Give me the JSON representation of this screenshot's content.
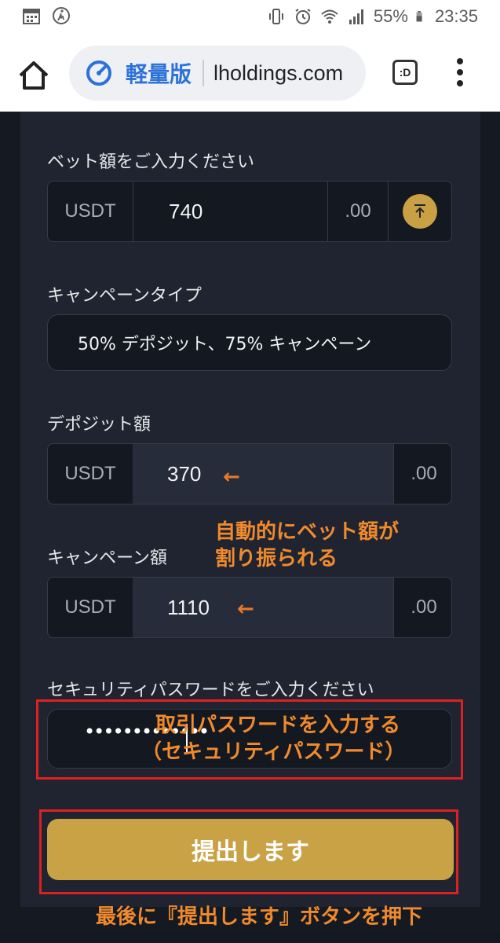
{
  "status_bar": {
    "battery": "55%",
    "time": "23:35"
  },
  "browser": {
    "lite_label": "軽量版",
    "url": "lholdings.com",
    "tab_label": ":D"
  },
  "form": {
    "bet": {
      "label": "ベット額をご入力ください",
      "currency": "USDT",
      "value": "740",
      "decimal": ".00"
    },
    "campaign_type": {
      "label": "キャンペーンタイプ",
      "value": "50% デポジット、75% キャンペーン"
    },
    "deposit": {
      "label": "デポジット額",
      "currency": "USDT",
      "value": "370",
      "decimal": ".00"
    },
    "campaign_amount": {
      "label": "キャンペーン額",
      "currency": "USDT",
      "value": "1110",
      "decimal": ".00"
    },
    "security_password": {
      "label": "セキュリティパスワードをご入力ください",
      "masked_value": "•••••••••••••"
    },
    "submit_label": "提出します"
  },
  "annotations": {
    "arrow": "←",
    "auto_split_line1": "自動的にベット額が",
    "auto_split_line2": "割り振られる",
    "password_line1": "取引パスワードを入力する",
    "password_line2": "（セキュリティパスワード）",
    "final_step": "最後に『提出します』ボタンを押下"
  },
  "colors": {
    "accent_gold": "#c9a246",
    "annotation_orange": "#f08a2c",
    "highlight_red": "#e02020",
    "lite_blue": "#2d72d9"
  }
}
